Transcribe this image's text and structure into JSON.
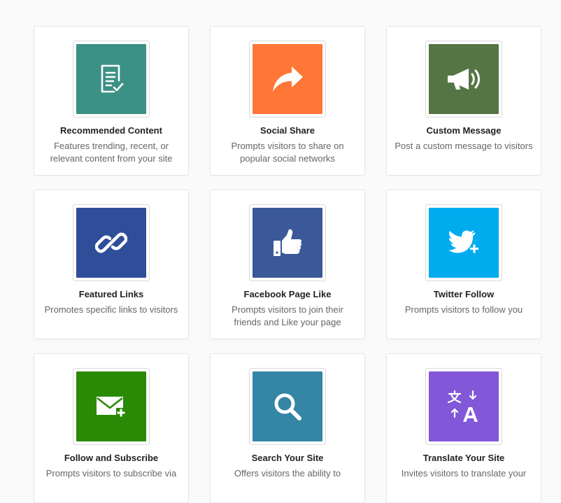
{
  "cards": [
    {
      "title": "Recommended Content",
      "description": "Features trending, recent, or relevant content from your site",
      "color": "#3b9185",
      "icon": "document-check-icon"
    },
    {
      "title": "Social Share",
      "description": "Prompts visitors to share on popular social networks",
      "color": "#ff7737",
      "icon": "share-arrow-icon"
    },
    {
      "title": "Custom Message",
      "description": "Post a custom message to visitors",
      "color": "#557545",
      "icon": "megaphone-icon"
    },
    {
      "title": "Featured Links",
      "description": "Promotes specific links to visitors",
      "color": "#2f4d99",
      "icon": "link-icon"
    },
    {
      "title": "Facebook Page Like",
      "description": "Prompts visitors to join their friends and Like your page",
      "color": "#3b5998",
      "icon": "thumbs-up-icon"
    },
    {
      "title": "Twitter Follow",
      "description": "Prompts visitors to follow you",
      "color": "#00acee",
      "icon": "twitter-bird-plus-icon"
    },
    {
      "title": "Follow and Subscribe",
      "description": "Prompts visitors to subscribe via",
      "color": "#2a8a06",
      "icon": "envelope-plus-icon"
    },
    {
      "title": "Search Your Site",
      "description": "Offers visitors the ability to",
      "color": "#3485a6",
      "icon": "search-icon"
    },
    {
      "title": "Translate Your Site",
      "description": "Invites visitors to translate your",
      "color": "#8257d8",
      "icon": "translate-icon"
    }
  ]
}
